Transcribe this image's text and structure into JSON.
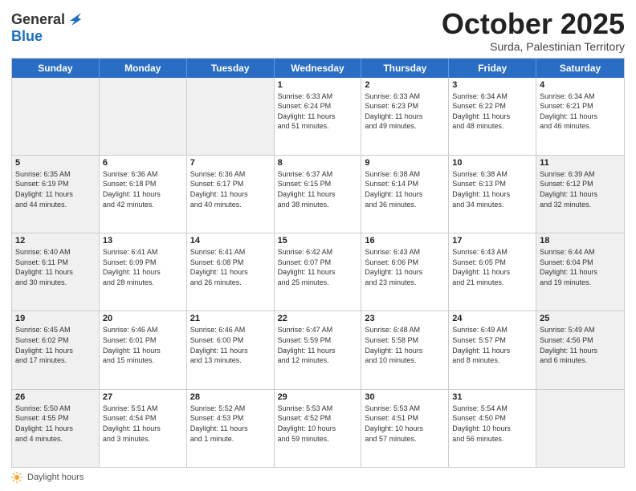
{
  "header": {
    "logo_line1": "General",
    "logo_line2": "Blue",
    "month": "October 2025",
    "location": "Surda, Palestinian Territory"
  },
  "days_of_week": [
    "Sunday",
    "Monday",
    "Tuesday",
    "Wednesday",
    "Thursday",
    "Friday",
    "Saturday"
  ],
  "weeks": [
    [
      {
        "day": "",
        "text": "",
        "shaded": true
      },
      {
        "day": "",
        "text": "",
        "shaded": true
      },
      {
        "day": "",
        "text": "",
        "shaded": true
      },
      {
        "day": "1",
        "text": "Sunrise: 6:33 AM\nSunset: 6:24 PM\nDaylight: 11 hours\nand 51 minutes.",
        "shaded": false
      },
      {
        "day": "2",
        "text": "Sunrise: 6:33 AM\nSunset: 6:23 PM\nDaylight: 11 hours\nand 49 minutes.",
        "shaded": false
      },
      {
        "day": "3",
        "text": "Sunrise: 6:34 AM\nSunset: 6:22 PM\nDaylight: 11 hours\nand 48 minutes.",
        "shaded": false
      },
      {
        "day": "4",
        "text": "Sunrise: 6:34 AM\nSunset: 6:21 PM\nDaylight: 11 hours\nand 46 minutes.",
        "shaded": false
      }
    ],
    [
      {
        "day": "5",
        "text": "Sunrise: 6:35 AM\nSunset: 6:19 PM\nDaylight: 11 hours\nand 44 minutes.",
        "shaded": true
      },
      {
        "day": "6",
        "text": "Sunrise: 6:36 AM\nSunset: 6:18 PM\nDaylight: 11 hours\nand 42 minutes.",
        "shaded": false
      },
      {
        "day": "7",
        "text": "Sunrise: 6:36 AM\nSunset: 6:17 PM\nDaylight: 11 hours\nand 40 minutes.",
        "shaded": false
      },
      {
        "day": "8",
        "text": "Sunrise: 6:37 AM\nSunset: 6:15 PM\nDaylight: 11 hours\nand 38 minutes.",
        "shaded": false
      },
      {
        "day": "9",
        "text": "Sunrise: 6:38 AM\nSunset: 6:14 PM\nDaylight: 11 hours\nand 36 minutes.",
        "shaded": false
      },
      {
        "day": "10",
        "text": "Sunrise: 6:38 AM\nSunset: 6:13 PM\nDaylight: 11 hours\nand 34 minutes.",
        "shaded": false
      },
      {
        "day": "11",
        "text": "Sunrise: 6:39 AM\nSunset: 6:12 PM\nDaylight: 11 hours\nand 32 minutes.",
        "shaded": true
      }
    ],
    [
      {
        "day": "12",
        "text": "Sunrise: 6:40 AM\nSunset: 6:11 PM\nDaylight: 11 hours\nand 30 minutes.",
        "shaded": true
      },
      {
        "day": "13",
        "text": "Sunrise: 6:41 AM\nSunset: 6:09 PM\nDaylight: 11 hours\nand 28 minutes.",
        "shaded": false
      },
      {
        "day": "14",
        "text": "Sunrise: 6:41 AM\nSunset: 6:08 PM\nDaylight: 11 hours\nand 26 minutes.",
        "shaded": false
      },
      {
        "day": "15",
        "text": "Sunrise: 6:42 AM\nSunset: 6:07 PM\nDaylight: 11 hours\nand 25 minutes.",
        "shaded": false
      },
      {
        "day": "16",
        "text": "Sunrise: 6:43 AM\nSunset: 6:06 PM\nDaylight: 11 hours\nand 23 minutes.",
        "shaded": false
      },
      {
        "day": "17",
        "text": "Sunrise: 6:43 AM\nSunset: 6:05 PM\nDaylight: 11 hours\nand 21 minutes.",
        "shaded": false
      },
      {
        "day": "18",
        "text": "Sunrise: 6:44 AM\nSunset: 6:04 PM\nDaylight: 11 hours\nand 19 minutes.",
        "shaded": true
      }
    ],
    [
      {
        "day": "19",
        "text": "Sunrise: 6:45 AM\nSunset: 6:02 PM\nDaylight: 11 hours\nand 17 minutes.",
        "shaded": true
      },
      {
        "day": "20",
        "text": "Sunrise: 6:46 AM\nSunset: 6:01 PM\nDaylight: 11 hours\nand 15 minutes.",
        "shaded": false
      },
      {
        "day": "21",
        "text": "Sunrise: 6:46 AM\nSunset: 6:00 PM\nDaylight: 11 hours\nand 13 minutes.",
        "shaded": false
      },
      {
        "day": "22",
        "text": "Sunrise: 6:47 AM\nSunset: 5:59 PM\nDaylight: 11 hours\nand 12 minutes.",
        "shaded": false
      },
      {
        "day": "23",
        "text": "Sunrise: 6:48 AM\nSunset: 5:58 PM\nDaylight: 11 hours\nand 10 minutes.",
        "shaded": false
      },
      {
        "day": "24",
        "text": "Sunrise: 6:49 AM\nSunset: 5:57 PM\nDaylight: 11 hours\nand 8 minutes.",
        "shaded": false
      },
      {
        "day": "25",
        "text": "Sunrise: 5:49 AM\nSunset: 4:56 PM\nDaylight: 11 hours\nand 6 minutes.",
        "shaded": true
      }
    ],
    [
      {
        "day": "26",
        "text": "Sunrise: 5:50 AM\nSunset: 4:55 PM\nDaylight: 11 hours\nand 4 minutes.",
        "shaded": true
      },
      {
        "day": "27",
        "text": "Sunrise: 5:51 AM\nSunset: 4:54 PM\nDaylight: 11 hours\nand 3 minutes.",
        "shaded": false
      },
      {
        "day": "28",
        "text": "Sunrise: 5:52 AM\nSunset: 4:53 PM\nDaylight: 11 hours\nand 1 minute.",
        "shaded": false
      },
      {
        "day": "29",
        "text": "Sunrise: 5:53 AM\nSunset: 4:52 PM\nDaylight: 10 hours\nand 59 minutes.",
        "shaded": false
      },
      {
        "day": "30",
        "text": "Sunrise: 5:53 AM\nSunset: 4:51 PM\nDaylight: 10 hours\nand 57 minutes.",
        "shaded": false
      },
      {
        "day": "31",
        "text": "Sunrise: 5:54 AM\nSunset: 4:50 PM\nDaylight: 10 hours\nand 56 minutes.",
        "shaded": false
      },
      {
        "day": "",
        "text": "",
        "shaded": true
      }
    ]
  ],
  "footer": {
    "daylight_label": "Daylight hours"
  }
}
